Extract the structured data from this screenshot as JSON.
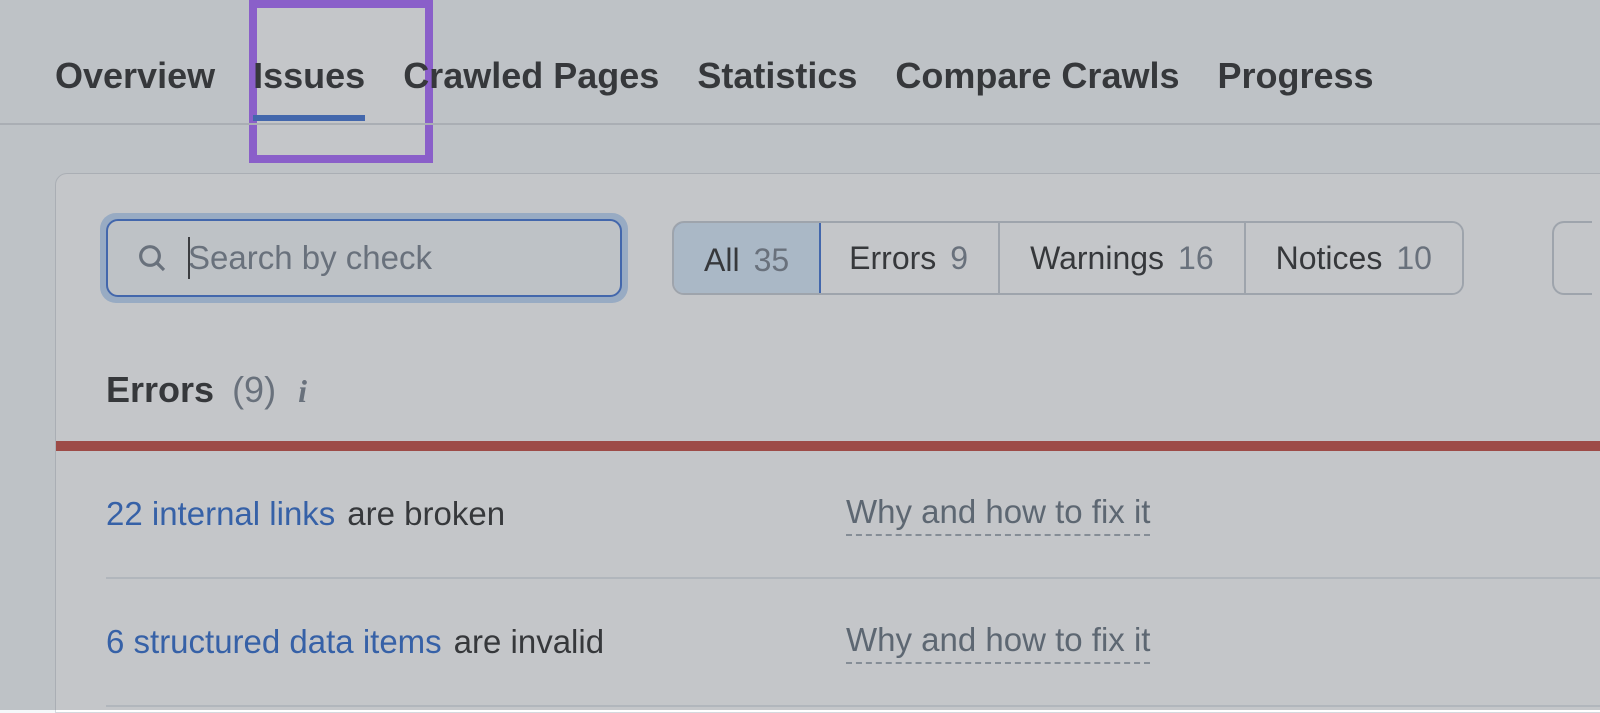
{
  "nav": {
    "tabs": [
      {
        "label": "Overview",
        "active": false
      },
      {
        "label": "Issues",
        "active": true
      },
      {
        "label": "Crawled Pages",
        "active": false
      },
      {
        "label": "Statistics",
        "active": false
      },
      {
        "label": "Compare Crawls",
        "active": false
      },
      {
        "label": "Progress",
        "active": false
      }
    ]
  },
  "search": {
    "placeholder": "Search by check",
    "value": ""
  },
  "filters": [
    {
      "id": "all",
      "label": "All",
      "count": 35,
      "selected": true
    },
    {
      "id": "errors",
      "label": "Errors",
      "count": 9,
      "selected": false
    },
    {
      "id": "warnings",
      "label": "Warnings",
      "count": 16,
      "selected": false
    },
    {
      "id": "notices",
      "label": "Notices",
      "count": 10,
      "selected": false
    }
  ],
  "section": {
    "title": "Errors",
    "countDisplay": "(9)"
  },
  "issues": [
    {
      "link": "22 internal links",
      "rest": "are broken",
      "fix": "Why and how to fix it"
    },
    {
      "link": "6 structured data items",
      "rest": "are invalid",
      "fix": "Why and how to fix it"
    }
  ]
}
